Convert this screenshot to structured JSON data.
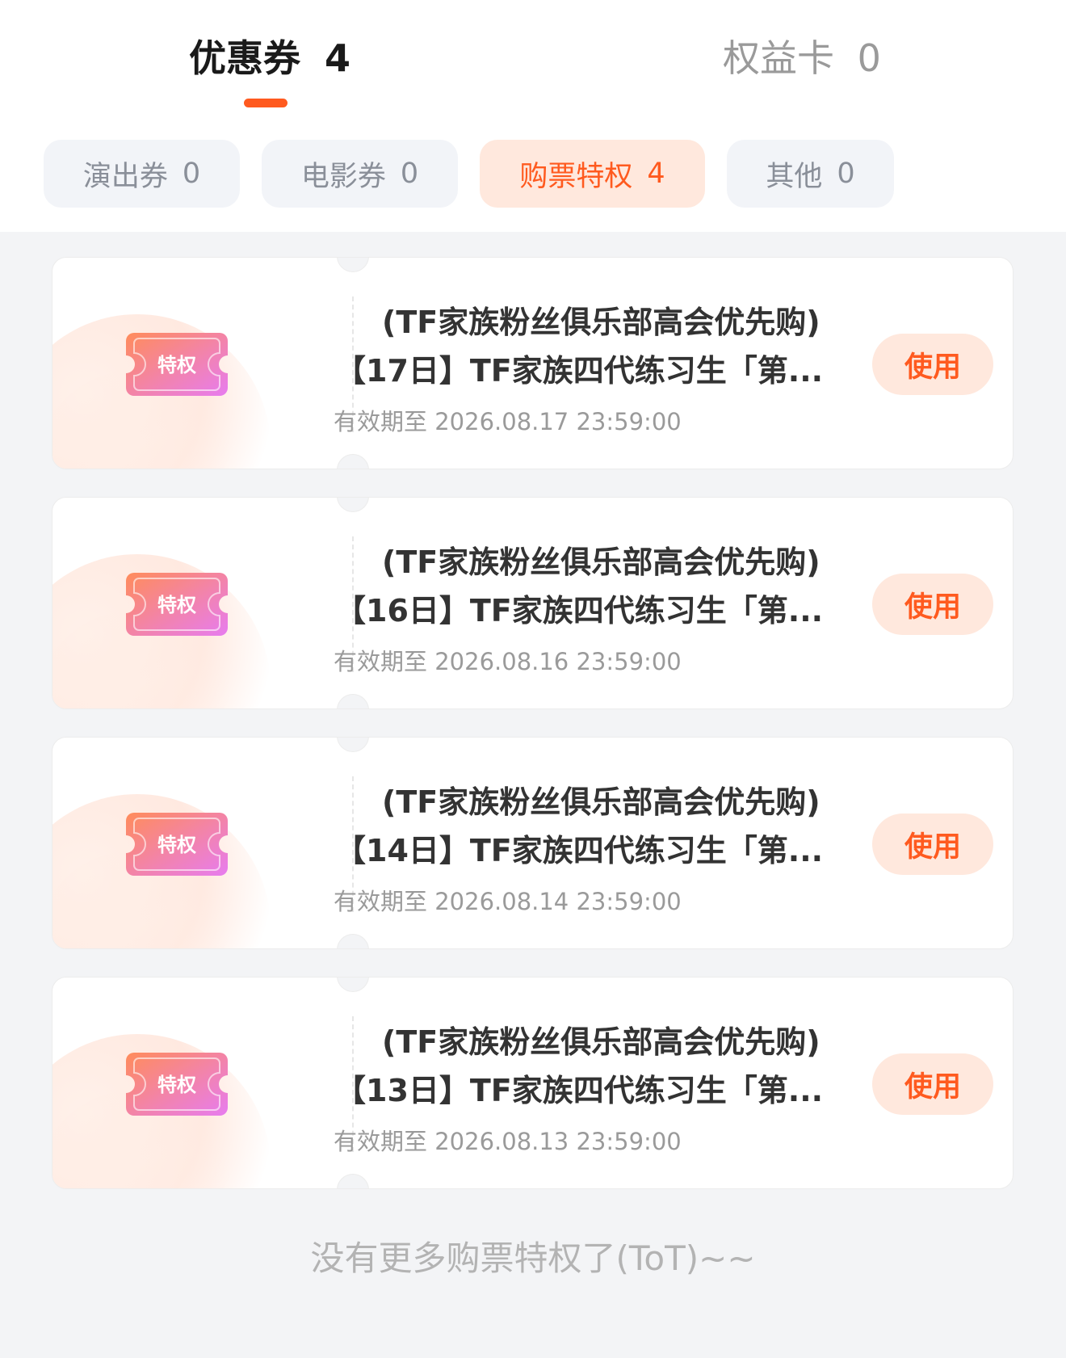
{
  "tabs": {
    "coupons_label": "优惠券",
    "coupons_count": "4",
    "benefits_label": "权益卡",
    "benefits_count": "0"
  },
  "chips": [
    {
      "label": "演出券",
      "count": "0"
    },
    {
      "label": "电影券",
      "count": "0"
    },
    {
      "label": "购票特权",
      "count": "4"
    },
    {
      "label": "其他",
      "count": "0"
    }
  ],
  "cards": [
    {
      "title_line1": "(TF家族粉丝俱乐部高会优先购)",
      "title_line2": "【17日】TF家族四代练习生「第...",
      "validity": "有效期至 2026.08.17 23:59:00",
      "badge": "特权",
      "button": "使用"
    },
    {
      "title_line1": "(TF家族粉丝俱乐部高会优先购)",
      "title_line2": "【16日】TF家族四代练习生「第...",
      "validity": "有效期至 2026.08.16 23:59:00",
      "badge": "特权",
      "button": "使用"
    },
    {
      "title_line1": "(TF家族粉丝俱乐部高会优先购)",
      "title_line2": "【14日】TF家族四代练习生「第...",
      "validity": "有效期至 2026.08.14 23:59:00",
      "badge": "特权",
      "button": "使用"
    },
    {
      "title_line1": "(TF家族粉丝俱乐部高会优先购)",
      "title_line2": "【13日】TF家族四代练习生「第...",
      "validity": "有效期至 2026.08.13 23:59:00",
      "badge": "特权",
      "button": "使用"
    }
  ],
  "footer": "没有更多购票特权了(ToT)~~",
  "colors": {
    "accent": "#ff5a1f",
    "accent_bg": "#ffe8dd",
    "badge_gradient_start": "#ff8c5a",
    "badge_gradient_end": "#e77cf0"
  },
  "icons": {
    "badge": "privilege-ticket-icon"
  }
}
